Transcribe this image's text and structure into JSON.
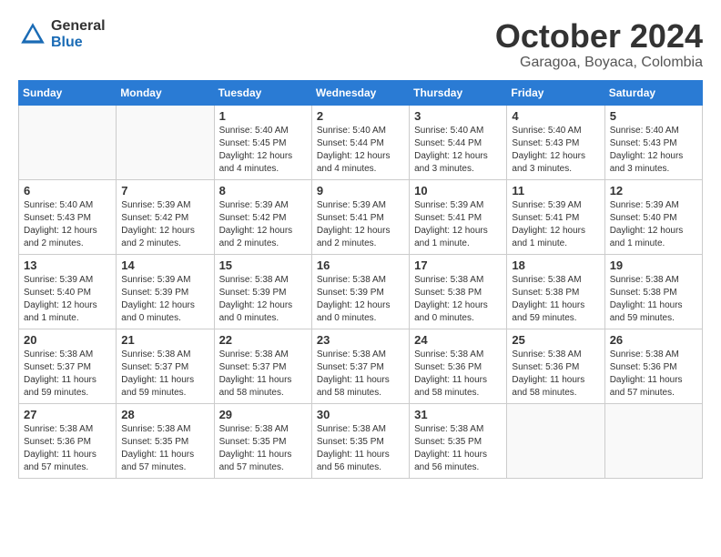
{
  "header": {
    "logo_general": "General",
    "logo_blue": "Blue",
    "month_title": "October 2024",
    "location": "Garagoa, Boyaca, Colombia"
  },
  "weekdays": [
    "Sunday",
    "Monday",
    "Tuesday",
    "Wednesday",
    "Thursday",
    "Friday",
    "Saturday"
  ],
  "weeks": [
    [
      {
        "day": "",
        "content": ""
      },
      {
        "day": "",
        "content": ""
      },
      {
        "day": "1",
        "content": "Sunrise: 5:40 AM\nSunset: 5:45 PM\nDaylight: 12 hours\nand 4 minutes."
      },
      {
        "day": "2",
        "content": "Sunrise: 5:40 AM\nSunset: 5:44 PM\nDaylight: 12 hours\nand 4 minutes."
      },
      {
        "day": "3",
        "content": "Sunrise: 5:40 AM\nSunset: 5:44 PM\nDaylight: 12 hours\nand 3 minutes."
      },
      {
        "day": "4",
        "content": "Sunrise: 5:40 AM\nSunset: 5:43 PM\nDaylight: 12 hours\nand 3 minutes."
      },
      {
        "day": "5",
        "content": "Sunrise: 5:40 AM\nSunset: 5:43 PM\nDaylight: 12 hours\nand 3 minutes."
      }
    ],
    [
      {
        "day": "6",
        "content": "Sunrise: 5:40 AM\nSunset: 5:43 PM\nDaylight: 12 hours\nand 2 minutes."
      },
      {
        "day": "7",
        "content": "Sunrise: 5:39 AM\nSunset: 5:42 PM\nDaylight: 12 hours\nand 2 minutes."
      },
      {
        "day": "8",
        "content": "Sunrise: 5:39 AM\nSunset: 5:42 PM\nDaylight: 12 hours\nand 2 minutes."
      },
      {
        "day": "9",
        "content": "Sunrise: 5:39 AM\nSunset: 5:41 PM\nDaylight: 12 hours\nand 2 minutes."
      },
      {
        "day": "10",
        "content": "Sunrise: 5:39 AM\nSunset: 5:41 PM\nDaylight: 12 hours\nand 1 minute."
      },
      {
        "day": "11",
        "content": "Sunrise: 5:39 AM\nSunset: 5:41 PM\nDaylight: 12 hours\nand 1 minute."
      },
      {
        "day": "12",
        "content": "Sunrise: 5:39 AM\nSunset: 5:40 PM\nDaylight: 12 hours\nand 1 minute."
      }
    ],
    [
      {
        "day": "13",
        "content": "Sunrise: 5:39 AM\nSunset: 5:40 PM\nDaylight: 12 hours\nand 1 minute."
      },
      {
        "day": "14",
        "content": "Sunrise: 5:39 AM\nSunset: 5:39 PM\nDaylight: 12 hours\nand 0 minutes."
      },
      {
        "day": "15",
        "content": "Sunrise: 5:38 AM\nSunset: 5:39 PM\nDaylight: 12 hours\nand 0 minutes."
      },
      {
        "day": "16",
        "content": "Sunrise: 5:38 AM\nSunset: 5:39 PM\nDaylight: 12 hours\nand 0 minutes."
      },
      {
        "day": "17",
        "content": "Sunrise: 5:38 AM\nSunset: 5:38 PM\nDaylight: 12 hours\nand 0 minutes."
      },
      {
        "day": "18",
        "content": "Sunrise: 5:38 AM\nSunset: 5:38 PM\nDaylight: 11 hours\nand 59 minutes."
      },
      {
        "day": "19",
        "content": "Sunrise: 5:38 AM\nSunset: 5:38 PM\nDaylight: 11 hours\nand 59 minutes."
      }
    ],
    [
      {
        "day": "20",
        "content": "Sunrise: 5:38 AM\nSunset: 5:37 PM\nDaylight: 11 hours\nand 59 minutes."
      },
      {
        "day": "21",
        "content": "Sunrise: 5:38 AM\nSunset: 5:37 PM\nDaylight: 11 hours\nand 59 minutes."
      },
      {
        "day": "22",
        "content": "Sunrise: 5:38 AM\nSunset: 5:37 PM\nDaylight: 11 hours\nand 58 minutes."
      },
      {
        "day": "23",
        "content": "Sunrise: 5:38 AM\nSunset: 5:37 PM\nDaylight: 11 hours\nand 58 minutes."
      },
      {
        "day": "24",
        "content": "Sunrise: 5:38 AM\nSunset: 5:36 PM\nDaylight: 11 hours\nand 58 minutes."
      },
      {
        "day": "25",
        "content": "Sunrise: 5:38 AM\nSunset: 5:36 PM\nDaylight: 11 hours\nand 58 minutes."
      },
      {
        "day": "26",
        "content": "Sunrise: 5:38 AM\nSunset: 5:36 PM\nDaylight: 11 hours\nand 57 minutes."
      }
    ],
    [
      {
        "day": "27",
        "content": "Sunrise: 5:38 AM\nSunset: 5:36 PM\nDaylight: 11 hours\nand 57 minutes."
      },
      {
        "day": "28",
        "content": "Sunrise: 5:38 AM\nSunset: 5:35 PM\nDaylight: 11 hours\nand 57 minutes."
      },
      {
        "day": "29",
        "content": "Sunrise: 5:38 AM\nSunset: 5:35 PM\nDaylight: 11 hours\nand 57 minutes."
      },
      {
        "day": "30",
        "content": "Sunrise: 5:38 AM\nSunset: 5:35 PM\nDaylight: 11 hours\nand 56 minutes."
      },
      {
        "day": "31",
        "content": "Sunrise: 5:38 AM\nSunset: 5:35 PM\nDaylight: 11 hours\nand 56 minutes."
      },
      {
        "day": "",
        "content": ""
      },
      {
        "day": "",
        "content": ""
      }
    ]
  ]
}
